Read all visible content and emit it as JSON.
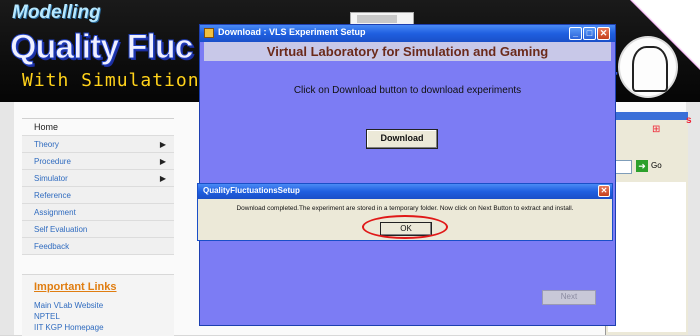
{
  "banner": {
    "line1": "Modelling",
    "line2": "Quality Fluc",
    "line3": "With Simulation",
    "logo_letter": "r"
  },
  "sidebar": {
    "items": [
      {
        "label": "Home",
        "arrow": ""
      },
      {
        "label": "Theory",
        "arrow": "▶"
      },
      {
        "label": "Procedure",
        "arrow": "▶"
      },
      {
        "label": "Simulator",
        "arrow": "▶"
      },
      {
        "label": "Reference",
        "arrow": ""
      },
      {
        "label": "Assignment",
        "arrow": ""
      },
      {
        "label": "Self Evaluation",
        "arrow": ""
      },
      {
        "label": "Feedback",
        "arrow": ""
      }
    ]
  },
  "important_links": {
    "title": "Important Links",
    "links": [
      "Main VLab Website",
      "NPTEL",
      "IIT KGP Homepage"
    ]
  },
  "explorer": {
    "go_label": "Go",
    "red_text": "s"
  },
  "setup_window": {
    "title": "Download  : VLS Experiment Setup",
    "header": "Virtual Laboratory for Simulation and Gaming",
    "instruction": "Click on Download button to download experiments",
    "download_label": "Download",
    "next_label": "Next",
    "min_glyph": "_",
    "max_glyph": "□",
    "close_glyph": "✕"
  },
  "message_box": {
    "title": "QualityFluctuationsSetup",
    "message": "Download completed.The experiment are stored in a temporary folder.  Now click on Next Button to extract and install.",
    "ok_label": "OK",
    "close_glyph": "✕"
  },
  "colors": {
    "setup_bg": "#7c7cf4",
    "highlight_ring": "#e01818",
    "header_text": "#6b2a1a"
  }
}
